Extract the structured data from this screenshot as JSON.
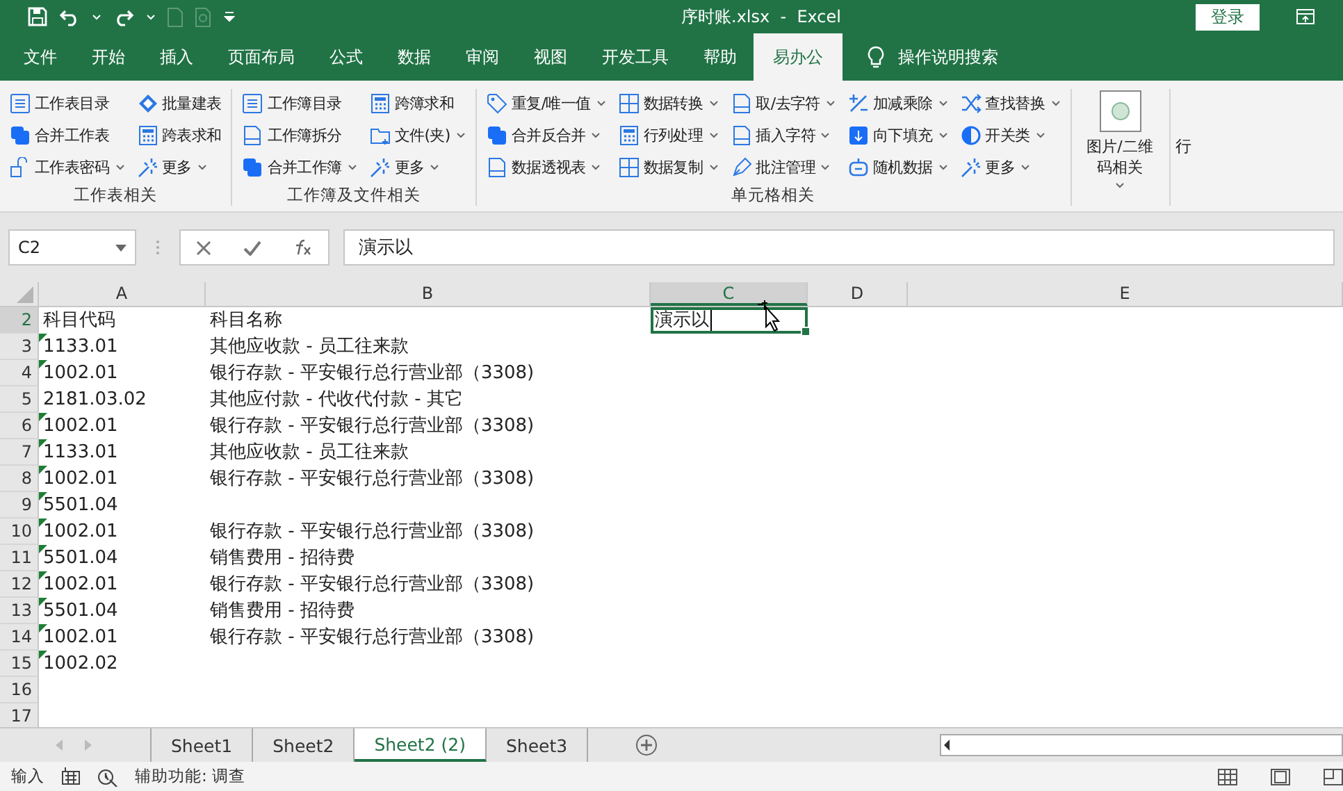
{
  "title_bar": {
    "title": "序时账.xlsx  -  Excel",
    "login": "登录"
  },
  "menu_tabs": [
    {
      "label": "文件",
      "selected": false
    },
    {
      "label": "开始",
      "selected": false
    },
    {
      "label": "插入",
      "selected": false
    },
    {
      "label": "页面布局",
      "selected": false
    },
    {
      "label": "公式",
      "selected": false
    },
    {
      "label": "数据",
      "selected": false
    },
    {
      "label": "审阅",
      "selected": false
    },
    {
      "label": "视图",
      "selected": false
    },
    {
      "label": "开发工具",
      "selected": false
    },
    {
      "label": "帮助",
      "selected": false
    },
    {
      "label": "易办公",
      "selected": true
    }
  ],
  "tell_me": "操作说明搜索",
  "ribbon": {
    "groups": [
      {
        "title": "工作表相关",
        "columns": [
          [
            {
              "label": "工作表目录",
              "dropdown": false
            },
            {
              "label": "合并工作表",
              "dropdown": false
            },
            {
              "label": "工作表密码",
              "dropdown": true
            }
          ],
          [
            {
              "label": "批量建表",
              "dropdown": false
            },
            {
              "label": "跨表求和",
              "dropdown": false
            },
            {
              "label": "更多",
              "dropdown": true
            }
          ]
        ]
      },
      {
        "title": "工作簿及文件相关",
        "columns": [
          [
            {
              "label": "工作簿目录",
              "dropdown": false
            },
            {
              "label": "工作簿拆分",
              "dropdown": false
            },
            {
              "label": "合并工作簿",
              "dropdown": true
            }
          ],
          [
            {
              "label": "跨簿求和",
              "dropdown": false
            },
            {
              "label": "文件(夹)",
              "dropdown": true
            },
            {
              "label": "更多",
              "dropdown": true
            }
          ]
        ]
      },
      {
        "title": "单元格相关",
        "columns": [
          [
            {
              "label": "重复/唯一值",
              "dropdown": true
            },
            {
              "label": "合并反合并",
              "dropdown": true
            },
            {
              "label": "数据透视表",
              "dropdown": true
            }
          ],
          [
            {
              "label": "数据转换",
              "dropdown": true
            },
            {
              "label": "行列处理",
              "dropdown": true
            },
            {
              "label": "数据复制",
              "dropdown": true
            }
          ],
          [
            {
              "label": "取/去字符",
              "dropdown": true
            },
            {
              "label": "插入字符",
              "dropdown": true
            },
            {
              "label": "批注管理",
              "dropdown": true
            }
          ],
          [
            {
              "label": "加减乘除",
              "dropdown": true
            },
            {
              "label": "向下填充",
              "dropdown": true
            },
            {
              "label": "随机数据",
              "dropdown": true
            }
          ],
          [
            {
              "label": "查找替换",
              "dropdown": true
            },
            {
              "label": "开关类",
              "dropdown": true
            },
            {
              "label": "更多",
              "dropdown": true
            }
          ]
        ]
      }
    ],
    "big_button": {
      "label": "图片/二维码相关",
      "dropdown": true
    },
    "cut_group_label": "行"
  },
  "formula_bar": {
    "name_box": "C2",
    "formula": "演示以"
  },
  "sheet": {
    "columns": [
      {
        "label": "A",
        "selected": false
      },
      {
        "label": "B",
        "selected": false
      },
      {
        "label": "C",
        "selected": true
      },
      {
        "label": "D",
        "selected": false
      },
      {
        "label": "E",
        "selected": false
      }
    ],
    "rows": [
      {
        "number": "2",
        "selected": true,
        "cells": [
          "科目代码",
          "科目名称",
          "演示以"
        ]
      },
      {
        "number": "3",
        "selected": false,
        "error_flag": true,
        "cells": [
          "1133.01",
          "其他应收款 - 员工往来款"
        ]
      },
      {
        "number": "4",
        "selected": false,
        "error_flag": true,
        "cells": [
          "1002.01",
          "银行存款 - 平安银行总行营业部（3308)"
        ]
      },
      {
        "number": "5",
        "selected": false,
        "error_flag": false,
        "cells": [
          "2181.03.02",
          "其他应付款 - 代收代付款 - 其它"
        ]
      },
      {
        "number": "6",
        "selected": false,
        "error_flag": true,
        "cells": [
          "1002.01",
          "银行存款 - 平安银行总行营业部（3308)"
        ]
      },
      {
        "number": "7",
        "selected": false,
        "error_flag": true,
        "cells": [
          "1133.01",
          "其他应收款 - 员工往来款"
        ]
      },
      {
        "number": "8",
        "selected": false,
        "error_flag": true,
        "cells": [
          "1002.01",
          "银行存款 - 平安银行总行营业部（3308)"
        ]
      },
      {
        "number": "9",
        "selected": false,
        "error_flag": true,
        "cells": [
          "5501.04"
        ]
      },
      {
        "number": "10",
        "selected": false,
        "error_flag": true,
        "cells": [
          "1002.01",
          "银行存款 - 平安银行总行营业部（3308)"
        ]
      },
      {
        "number": "11",
        "selected": false,
        "error_flag": true,
        "cells": [
          "5501.04",
          "销售费用 - 招待费"
        ]
      },
      {
        "number": "12",
        "selected": false,
        "error_flag": true,
        "cells": [
          "1002.01",
          "银行存款 - 平安银行总行营业部（3308)"
        ]
      },
      {
        "number": "13",
        "selected": false,
        "error_flag": true,
        "cells": [
          "5501.04",
          "销售费用 - 招待费"
        ]
      },
      {
        "number": "14",
        "selected": false,
        "error_flag": true,
        "cells": [
          "1002.01",
          "银行存款 - 平安银行总行营业部（3308)"
        ]
      },
      {
        "number": "15",
        "selected": false,
        "error_flag": true,
        "cells": [
          "1002.02"
        ]
      },
      {
        "number": "16",
        "selected": false
      },
      {
        "number": "17",
        "selected": false
      }
    ]
  },
  "sheet_tabs": [
    {
      "label": "Sheet1",
      "selected": false
    },
    {
      "label": "Sheet2",
      "selected": false
    },
    {
      "label": "Sheet2 (2)",
      "selected": true
    },
    {
      "label": "Sheet3",
      "selected": false
    }
  ],
  "status_bar": {
    "mode": "输入",
    "accessibility": "辅助功能: 调查"
  }
}
